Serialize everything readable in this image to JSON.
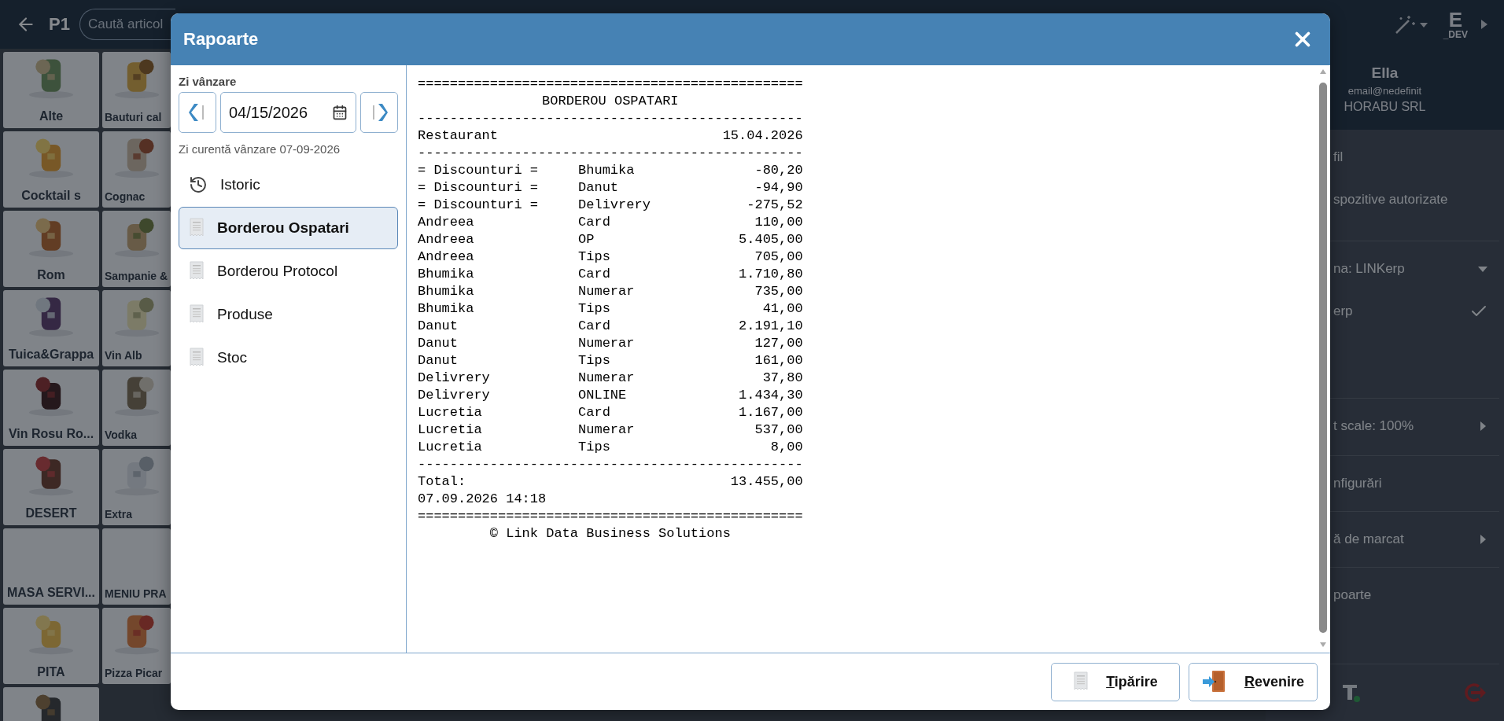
{
  "app_bar": {
    "label": "P1",
    "search": {
      "placeholder": "Caută articol"
    },
    "env_letter": "E",
    "env_tag": "_DEV"
  },
  "tiles": [
    {
      "label": "Alte",
      "kind": "picture"
    },
    {
      "label": "Bauturi cal",
      "kind": "picture"
    },
    {
      "label": "Cocktail s",
      "kind": "picture"
    },
    {
      "label": "Cognac",
      "kind": "picture"
    },
    {
      "label": "Rom",
      "kind": "picture"
    },
    {
      "label": "Sampanie &",
      "kind": "picture"
    },
    {
      "label": "Tuica&Grappa",
      "kind": "picture"
    },
    {
      "label": "Vin Alb",
      "kind": "picture"
    },
    {
      "label": "Vin Rosu Ro...",
      "kind": "picture"
    },
    {
      "label": "Vodka",
      "kind": "picture"
    },
    {
      "label": "DESERT",
      "kind": "picture"
    },
    {
      "label": "Extra",
      "kind": "picture"
    },
    {
      "label": "MASA SERVI...",
      "kind": "plain"
    },
    {
      "label": "MENIU PRA",
      "kind": "plain"
    },
    {
      "label": "PITA",
      "kind": "picture"
    },
    {
      "label": "Pizza Picar",
      "kind": "picture"
    },
    {
      "kind": "picture"
    }
  ],
  "profile": {
    "name": "Ella",
    "email": "email@nedefinit",
    "company": "HORABU SRL"
  },
  "side_menu": [
    {
      "items": [
        {
          "kind": "item",
          "label": "fil"
        },
        {
          "kind": "item",
          "label": "spozitive autorizate"
        }
      ]
    },
    {
      "items": [
        {
          "kind": "dropdown",
          "label": "na: LINKerp",
          "expanded": true
        },
        {
          "kind": "option",
          "label": "erp",
          "checked": true
        }
      ]
    },
    {
      "items": [
        {
          "kind": "submenu",
          "label": "t scale: 100%"
        }
      ]
    },
    {
      "items": [
        {
          "kind": "item",
          "label": "nfigurări"
        }
      ]
    },
    {
      "items": [
        {
          "kind": "submenu",
          "label": "ă de marcat"
        }
      ]
    },
    {
      "items": [
        {
          "kind": "item",
          "label": "poarte"
        }
      ]
    }
  ],
  "dialog": {
    "title": "Rapoarte",
    "date_label": "Zi vânzare",
    "date": "04/15/2026",
    "current_day": "Zi curentă vânzare 07-09-2026",
    "reports": [
      {
        "kind": "history",
        "label": "Istoric",
        "selected": false
      },
      {
        "kind": "report",
        "label": "Borderou Ospatari",
        "selected": true
      },
      {
        "kind": "report",
        "label": "Borderou Protocol",
        "selected": false
      },
      {
        "kind": "report",
        "label": "Produse",
        "selected": false
      },
      {
        "kind": "report",
        "label": "Stoc",
        "selected": false
      }
    ],
    "report_lines": [
      {
        "kind": "rule",
        "text": "================================================"
      },
      {
        "kind": "center",
        "text": "BORDEROU OSPATARI"
      },
      {
        "kind": "rule",
        "text": "------------------------------------------------"
      },
      {
        "kind": "pair",
        "cells": [
          "Restaurant",
          "15.04.2026"
        ]
      },
      {
        "kind": "rule",
        "text": "------------------------------------------------"
      },
      {
        "kind": "row",
        "cells": [
          "= Discounturi =",
          "Bhumika",
          "-80,20"
        ]
      },
      {
        "kind": "row",
        "cells": [
          "= Discounturi =",
          "Danut",
          "-94,90"
        ]
      },
      {
        "kind": "row",
        "cells": [
          "= Discounturi =",
          "Delivrery",
          "-275,52"
        ]
      },
      {
        "kind": "row",
        "cells": [
          "Andreea",
          "Card",
          "110,00"
        ]
      },
      {
        "kind": "row",
        "cells": [
          "Andreea",
          "OP",
          "5.405,00"
        ]
      },
      {
        "kind": "row",
        "cells": [
          "Andreea",
          "Tips",
          "705,00"
        ]
      },
      {
        "kind": "row",
        "cells": [
          "Bhumika",
          "Card",
          "1.710,80"
        ]
      },
      {
        "kind": "row",
        "cells": [
          "Bhumika",
          "Numerar",
          "735,00"
        ]
      },
      {
        "kind": "row",
        "cells": [
          "Bhumika",
          "Tips",
          "41,00"
        ]
      },
      {
        "kind": "row",
        "cells": [
          "Danut",
          "Card",
          "2.191,10"
        ]
      },
      {
        "kind": "row",
        "cells": [
          "Danut",
          "Numerar",
          "127,00"
        ]
      },
      {
        "kind": "row",
        "cells": [
          "Danut",
          "Tips",
          "161,00"
        ]
      },
      {
        "kind": "row",
        "cells": [
          "Delivrery",
          "Numerar",
          "37,80"
        ]
      },
      {
        "kind": "row",
        "cells": [
          "Delivrery",
          "ONLINE",
          "1.434,30"
        ]
      },
      {
        "kind": "row",
        "cells": [
          "Lucretia",
          "Card",
          "1.167,00"
        ]
      },
      {
        "kind": "row",
        "cells": [
          "Lucretia",
          "Numerar",
          "537,00"
        ]
      },
      {
        "kind": "row",
        "cells": [
          "Lucretia",
          "Tips",
          "8,00"
        ]
      },
      {
        "kind": "rule",
        "text": "------------------------------------------------"
      },
      {
        "kind": "pair",
        "cells": [
          "Total:",
          "13.455,00"
        ]
      },
      {
        "kind": "text",
        "text": "07.09.2026 14:18"
      },
      {
        "kind": "rule",
        "text": "================================================"
      },
      {
        "kind": "center",
        "text": "© Link Data Business Solutions"
      }
    ],
    "buttons": [
      {
        "kind": "print",
        "label": "Tipărire"
      },
      {
        "kind": "back",
        "label": "Revenire"
      }
    ]
  }
}
